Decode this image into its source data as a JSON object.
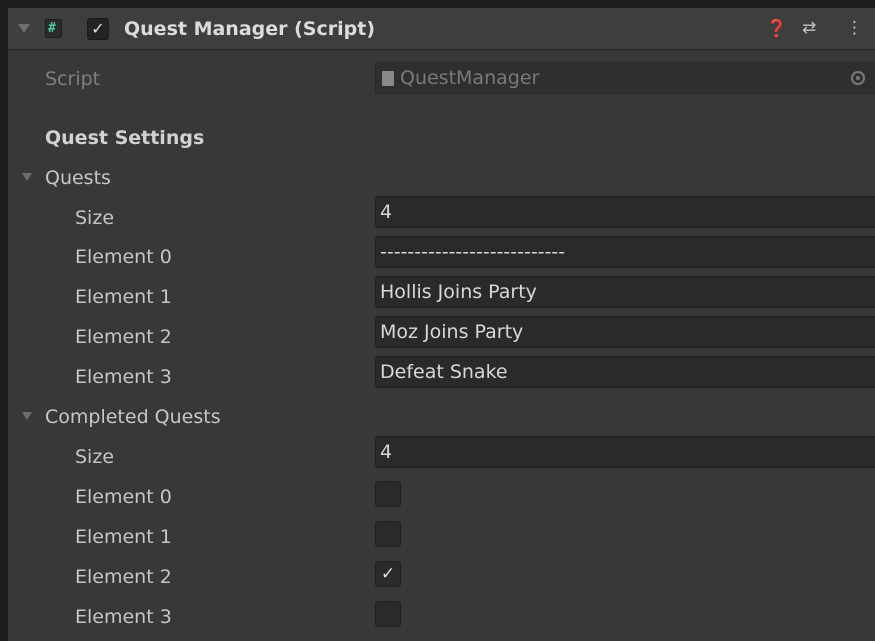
{
  "component": {
    "title": "Quest Manager (Script)",
    "enabled": true,
    "icons": [
      "foldout-arrow-icon",
      "csharp-script-icon",
      "help-icon",
      "preset-icon",
      "context-menu-icon"
    ]
  },
  "script": {
    "label": "Script",
    "value": "QuestManager"
  },
  "section": {
    "header": "Quest Settings"
  },
  "quests": {
    "label": "Quests",
    "size_label": "Size",
    "size": "4",
    "elements": [
      {
        "label": "Element 0",
        "value": "---------------------------"
      },
      {
        "label": "Element 1",
        "value": "Hollis Joins Party"
      },
      {
        "label": "Element 2",
        "value": "Moz Joins Party"
      },
      {
        "label": "Element 3",
        "value": "Defeat Snake"
      }
    ]
  },
  "completed_quests": {
    "label": "Completed Quests",
    "size_label": "Size",
    "size": "4",
    "elements": [
      {
        "label": "Element 0",
        "checked": false
      },
      {
        "label": "Element 1",
        "checked": false
      },
      {
        "label": "Element 2",
        "checked": true
      },
      {
        "label": "Element 3",
        "checked": false
      }
    ]
  },
  "colors": {
    "background": "#383838",
    "header": "#3e3e3e",
    "field": "#2a2a2a",
    "text": "#c6c6c6",
    "accent_script_icon": "#4ec9a0"
  }
}
